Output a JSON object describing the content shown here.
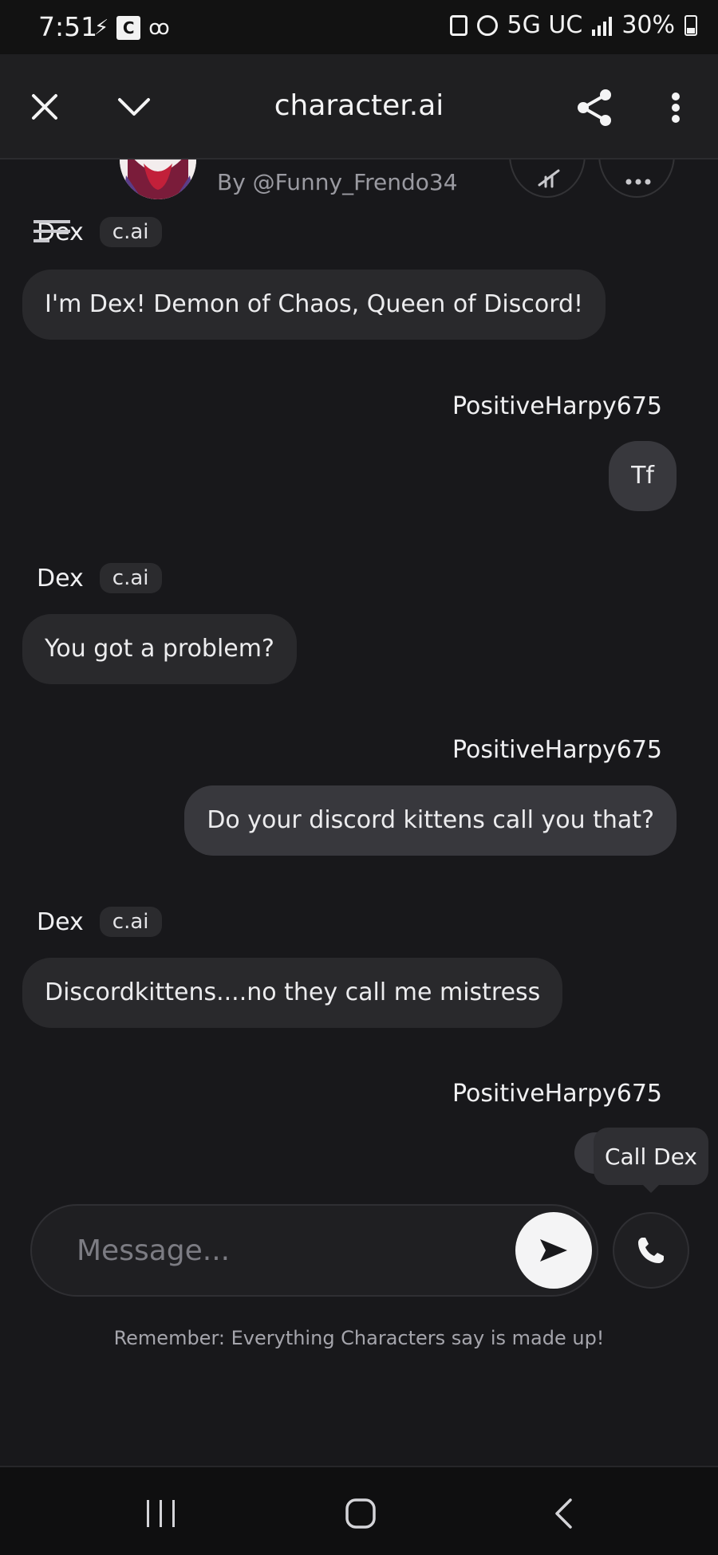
{
  "status_bar": {
    "time": "7:51",
    "carrier_icon_letter": "C",
    "network": "5G UC",
    "battery": "30%"
  },
  "header": {
    "title": "character.ai",
    "close_icon": "close-icon",
    "collapse_icon": "chevron-down-icon",
    "share_icon": "share-icon",
    "menu_icon": "more-vertical-icon"
  },
  "character": {
    "creator": "By @Funny_Frendo34"
  },
  "messages": [
    {
      "sender": "Dex",
      "badge": "c.ai",
      "text": "I'm Dex! Demon of Chaos, Queen of Discord!"
    },
    {
      "sender": "PositiveHarpy675",
      "text": "Tf"
    },
    {
      "sender": "Dex",
      "badge": "c.ai",
      "text": "You got a problem?"
    },
    {
      "sender": "PositiveHarpy675",
      "text": "Do your discord kittens call you that?"
    },
    {
      "sender": "Dex",
      "badge": "c.ai",
      "text": "Discordkittens....no they call me mistress"
    },
    {
      "sender": "PositiveHarpy675",
      "text": ""
    }
  ],
  "tooltip": {
    "text": "Call Dex"
  },
  "composer": {
    "placeholder": "Message...",
    "value": ""
  },
  "disclaimer": "Remember: Everything Characters say is made up!",
  "colors": {
    "background": "#18181b",
    "bot_bubble": "#29292c",
    "user_bubble": "#38383d",
    "send_button": "#f4f4f5"
  }
}
